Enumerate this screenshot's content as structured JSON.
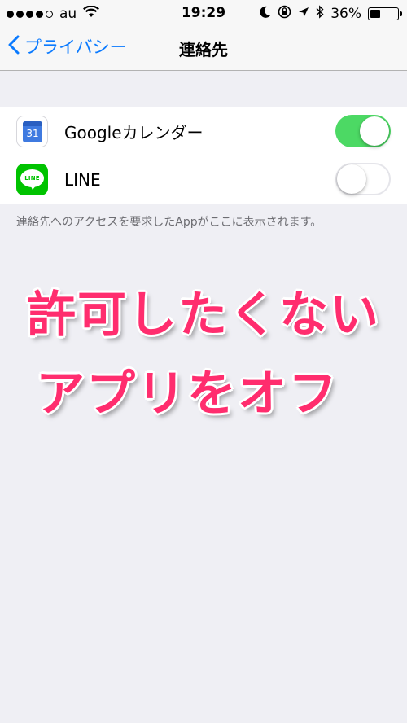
{
  "status_bar": {
    "carrier": "au",
    "time": "19:29",
    "battery_percent": "36%",
    "signal_bars_filled": 4,
    "signal_bars_total": 5
  },
  "nav": {
    "back_label": "プライバシー",
    "title": "連絡先"
  },
  "apps": [
    {
      "name": "Googleカレンダー",
      "icon": "google-calendar-icon",
      "icon_text": "31",
      "enabled": true
    },
    {
      "name": "LINE",
      "icon": "line-app-icon",
      "icon_text": "LINE",
      "enabled": false
    }
  ],
  "footer_text": "連絡先へのアクセスを要求したAppがここに表示されます。",
  "overlay": {
    "line1": "許可したくない",
    "line2": "アプリをオフ"
  },
  "colors": {
    "accent": "#0a7aff",
    "switch_on": "#4cd964",
    "overlay_text": "#ff2d6e",
    "line_green": "#00c300"
  }
}
